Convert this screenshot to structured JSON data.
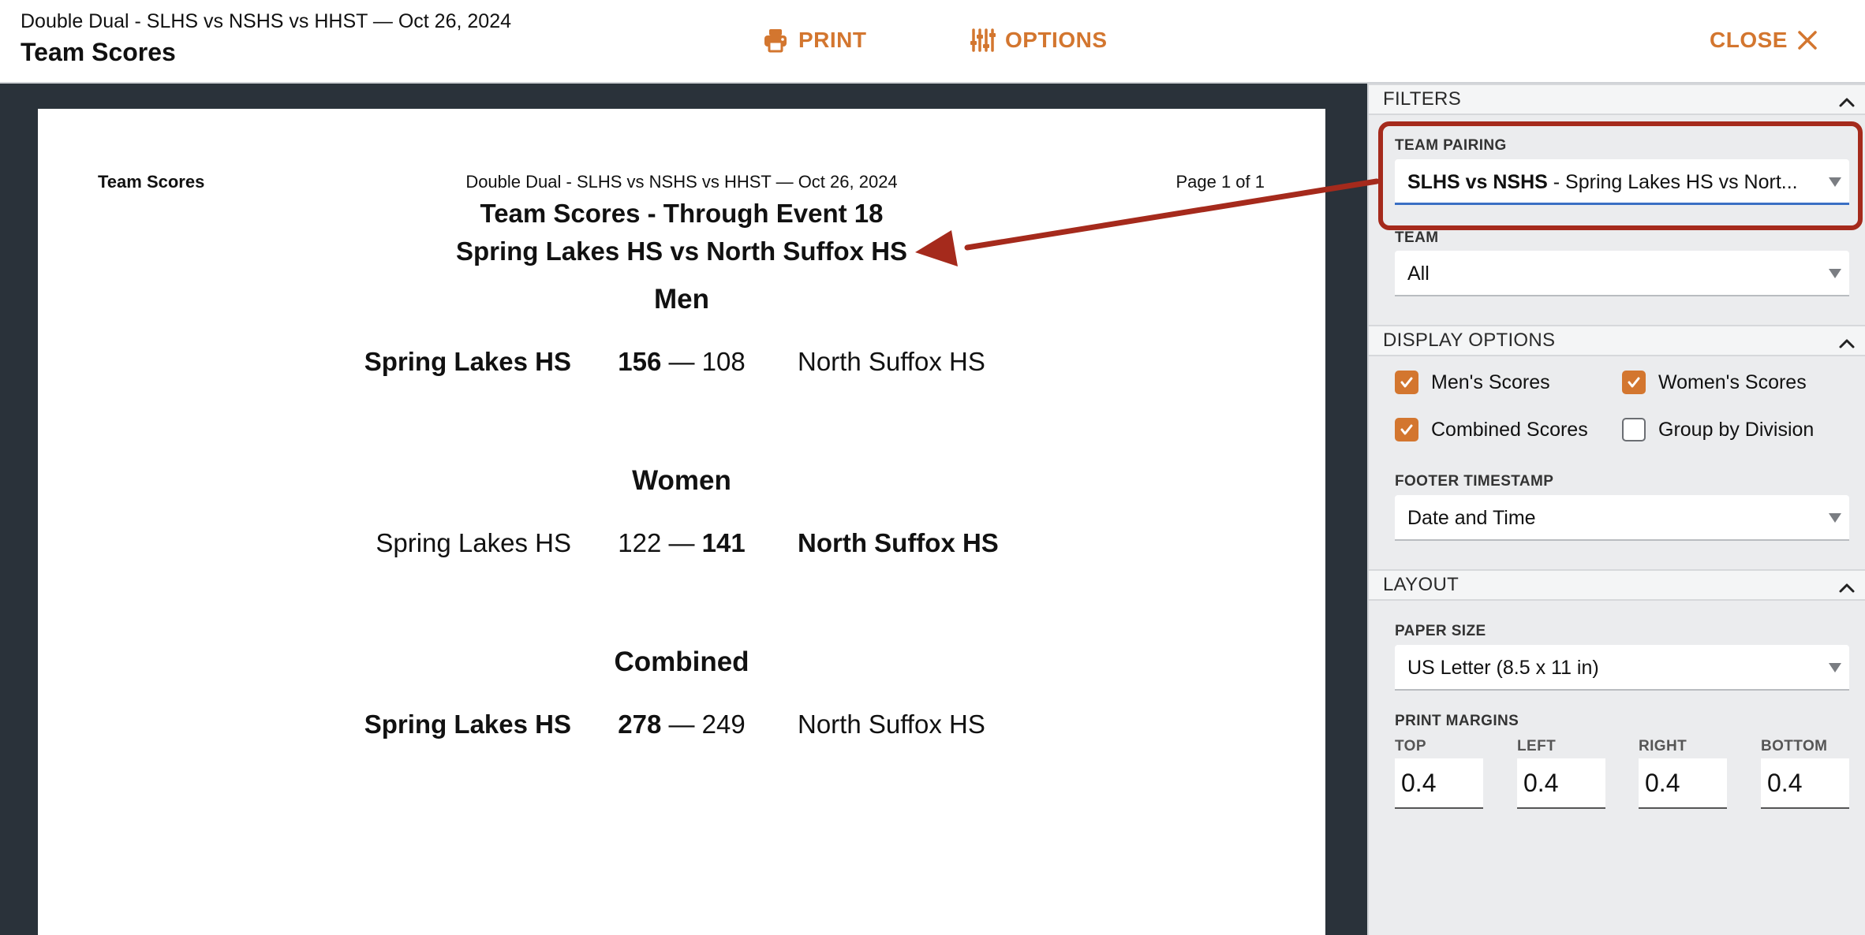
{
  "header": {
    "meet_name": "Double Dual - SLHS vs NSHS vs HHST — Oct 26, 2024",
    "title": "Team Scores",
    "print_label": "PRINT",
    "options_label": "OPTIONS",
    "close_label": "CLOSE"
  },
  "report": {
    "header_left": "Team Scores",
    "header_center": "Double Dual - SLHS vs NSHS vs HHST — Oct 26, 2024",
    "header_right": "Page 1 of 1",
    "title": "Team Scores - Through Event 18",
    "subtitle": "Spring Lakes HS vs North Suffox HS",
    "sections": [
      {
        "title": "Men",
        "team_left": "Spring Lakes HS",
        "score_left": "156",
        "separator": " — ",
        "score_right": "108",
        "team_right": "North Suffox HS",
        "winner": "left"
      },
      {
        "title": "Women",
        "team_left": "Spring Lakes HS",
        "score_left": "122",
        "separator": " — ",
        "score_right": "141",
        "team_right": "North Suffox HS",
        "winner": "right"
      },
      {
        "title": "Combined",
        "team_left": "Spring Lakes HS",
        "score_left": "278",
        "separator": " — ",
        "score_right": "249",
        "team_right": "North Suffox HS",
        "winner": "left"
      }
    ]
  },
  "sidebar": {
    "filters": {
      "title": "FILTERS",
      "team_pairing_label": "TEAM PAIRING",
      "team_pairing_bold": "SLHS vs NSHS",
      "team_pairing_rest": " - Spring Lakes HS vs Nort...",
      "team_label": "TEAM",
      "team_value": "All"
    },
    "display": {
      "title": "DISPLAY OPTIONS",
      "mens_scores": "Men's Scores",
      "womens_scores": "Women's Scores",
      "combined_scores": "Combined Scores",
      "group_by_division": "Group by Division",
      "mens_checked": true,
      "womens_checked": true,
      "combined_checked": true,
      "group_checked": false,
      "footer_label": "FOOTER TIMESTAMP",
      "footer_value": "Date and Time"
    },
    "layout": {
      "title": "LAYOUT",
      "paper_label": "PAPER SIZE",
      "paper_value": "US Letter (8.5 x 11 in)",
      "margins_label": "PRINT MARGINS",
      "top_label": "TOP",
      "left_label": "LEFT",
      "right_label": "RIGHT",
      "bottom_label": "BOTTOM",
      "top_value": "0.4",
      "left_value": "0.4",
      "right_value": "0.4",
      "bottom_value": "0.4"
    }
  },
  "colors": {
    "accent": "#d3762f",
    "annotation": "#a52a1c",
    "preview_bg": "#2a323a"
  }
}
